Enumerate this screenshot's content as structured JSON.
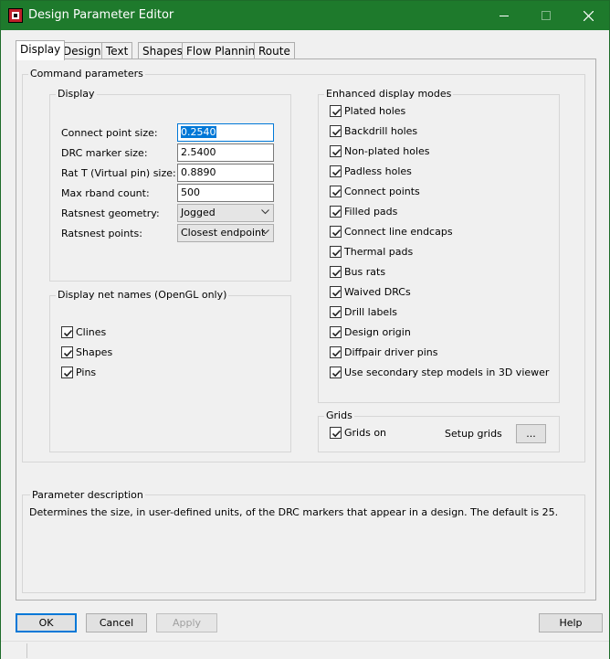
{
  "window": {
    "title": "Design Parameter Editor",
    "controls": [
      "minimize-icon",
      "maximize-icon",
      "close-icon"
    ]
  },
  "tabs": [
    {
      "label": "Display",
      "active": true
    },
    {
      "label": "Design",
      "active": false
    },
    {
      "label": "Text",
      "active": false
    },
    {
      "label": "Shapes",
      "active": false
    },
    {
      "label": "Flow Planning",
      "active": false
    },
    {
      "label": "Route",
      "active": false
    }
  ],
  "command_parameters": {
    "label": "Command parameters",
    "display": {
      "label": "Display",
      "fields": [
        {
          "label": "Connect point size:",
          "value": "0.2540",
          "kind": "text",
          "focused": true
        },
        {
          "label": "DRC marker size:",
          "value": "2.5400",
          "kind": "text"
        },
        {
          "label": "Rat T (Virtual pin) size:",
          "value": "0.8890",
          "kind": "text"
        },
        {
          "label": "Max rband count:",
          "value": "500",
          "kind": "text"
        },
        {
          "label": "Ratsnest geometry:",
          "value": "Jogged",
          "kind": "select"
        },
        {
          "label": "Ratsnest points:",
          "value": "Closest endpoint",
          "kind": "select"
        }
      ]
    },
    "net_names": {
      "label": "Display net names (OpenGL only)",
      "items": [
        {
          "label": "Clines",
          "checked": true
        },
        {
          "label": "Shapes",
          "checked": true
        },
        {
          "label": "Pins",
          "checked": true
        }
      ]
    },
    "enhanced": {
      "label": "Enhanced display modes",
      "items": [
        {
          "label": "Plated holes",
          "checked": true
        },
        {
          "label": "Backdrill holes",
          "checked": true
        },
        {
          "label": "Non-plated holes",
          "checked": true
        },
        {
          "label": "Padless holes",
          "checked": true
        },
        {
          "label": "Connect points",
          "checked": true
        },
        {
          "label": "Filled pads",
          "checked": true
        },
        {
          "label": "Connect line endcaps",
          "checked": true
        },
        {
          "label": "Thermal pads",
          "checked": true
        },
        {
          "label": "Bus rats",
          "checked": true
        },
        {
          "label": "Waived DRCs",
          "checked": true
        },
        {
          "label": "Drill labels",
          "checked": true
        },
        {
          "label": "Design origin",
          "checked": true
        },
        {
          "label": "Diffpair driver pins",
          "checked": true
        },
        {
          "label": "Use secondary step models in 3D viewer",
          "checked": true
        }
      ]
    },
    "grids": {
      "label": "Grids",
      "grids_on": {
        "label": "Grids on",
        "checked": true
      },
      "setup_label": "Setup grids",
      "setup_button": "..."
    }
  },
  "parameter_description": {
    "label": "Parameter description",
    "text": "Determines the size, in user-defined units, of the DRC markers that appear in a design. The default is 25."
  },
  "buttons": {
    "ok": "OK",
    "cancel": "Cancel",
    "apply": "Apply",
    "help": "Help"
  },
  "colors": {
    "titlebar": "#1e7a2c",
    "accent": "#0078d7"
  }
}
